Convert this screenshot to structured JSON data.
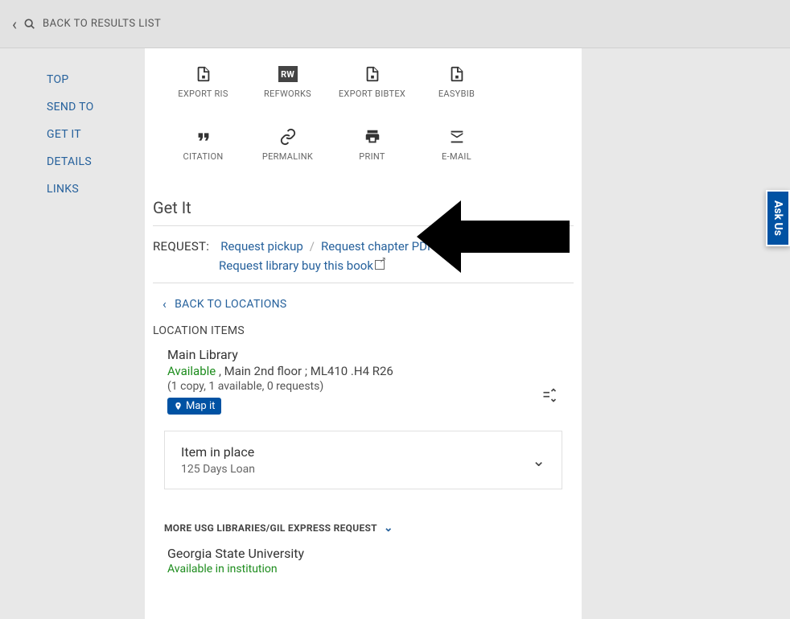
{
  "topbar": {
    "back_label": "BACK TO RESULTS LIST"
  },
  "sidebar": {
    "items": [
      {
        "label": "TOP"
      },
      {
        "label": "SEND TO"
      },
      {
        "label": "GET IT"
      },
      {
        "label": "DETAILS"
      },
      {
        "label": "LINKS"
      }
    ]
  },
  "actions_row1": [
    {
      "label": "EXPORT RIS",
      "icon": "file"
    },
    {
      "label": "REFWORKS",
      "icon": "rw"
    },
    {
      "label": "EXPORT BIBTEX",
      "icon": "file"
    },
    {
      "label": "EASYBIB",
      "icon": "file"
    }
  ],
  "actions_row2": [
    {
      "label": "CITATION",
      "icon": "quote"
    },
    {
      "label": "PERMALINK",
      "icon": "link"
    },
    {
      "label": "PRINT",
      "icon": "print"
    },
    {
      "label": "E-MAIL",
      "icon": "mail"
    }
  ],
  "getit": {
    "title": "Get It",
    "request_label": "REQUEST:",
    "links": {
      "pickup": "Request pickup",
      "chapter_pdf": "Request chapter PDF",
      "buy_book": "Request library buy this book"
    },
    "back_locations": "BACK TO LOCATIONS",
    "location_items_label": "LOCATION ITEMS",
    "location": {
      "name": "Main Library",
      "status": "Available",
      "detail": " , Main 2nd floor ; ML410 .H4 R26",
      "copy_info": "(1 copy, 1 available, 0 requests)",
      "map_it": "Map it"
    },
    "item_card": {
      "status": "Item in place",
      "loan": "125 Days Loan"
    },
    "more_label": "MORE USG LIBRARIES/GIL EXPRESS REQUEST",
    "other": {
      "name": "Georgia State University",
      "avail": "Available in institution"
    }
  },
  "askus": "Ask Us"
}
